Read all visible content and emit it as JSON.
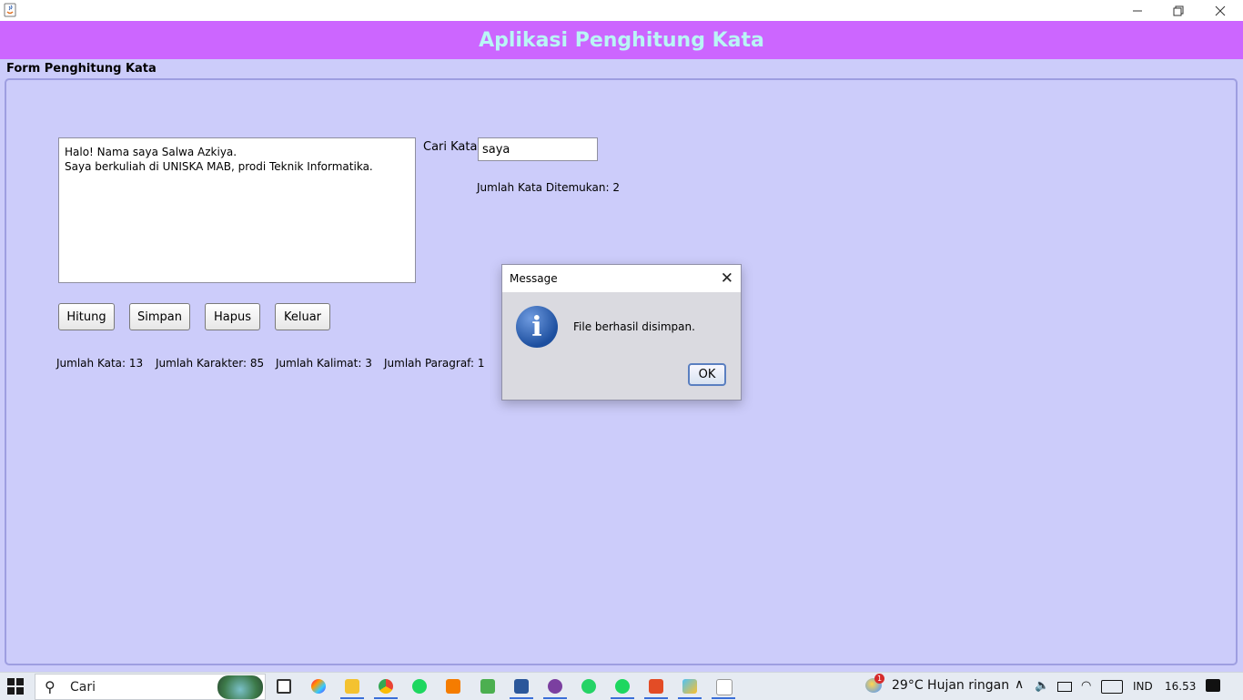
{
  "window": {
    "minimize_icon": "minimize-icon",
    "restore_icon": "restore-icon",
    "close_icon": "close-icon"
  },
  "header": {
    "title": "Aplikasi Penghitung Kata",
    "bg_color": "#cc66ff",
    "title_color": "#b9f5f5"
  },
  "form": {
    "section_label": "Form Penghitung Kata",
    "text_content": "Halo! Nama saya Salwa Azkiya.\nSaya berkuliah di UNISKA MAB, prodi Teknik Informatika.",
    "search_label": "Cari Kata",
    "search_value": "saya",
    "found_text": "Jumlah Kata Ditemukan: 2",
    "buttons": {
      "hitung": "Hitung",
      "simpan": "Simpan",
      "hapus": "Hapus",
      "keluar": "Keluar"
    },
    "stats": {
      "kata": "Jumlah Kata: 13",
      "karakter": "Jumlah Karakter: 85",
      "kalimat": "Jumlah Kalimat: 3",
      "paragraf": "Jumlah Paragraf: 1"
    }
  },
  "dialog": {
    "title": "Message",
    "message": "File berhasil disimpan.",
    "ok_label": "OK",
    "icon": "info-icon"
  },
  "taskbar": {
    "search_placeholder": "Cari",
    "weather": "29°C  Hujan ringan",
    "weather_badge": "1",
    "language": "IND",
    "time": "16.53"
  }
}
